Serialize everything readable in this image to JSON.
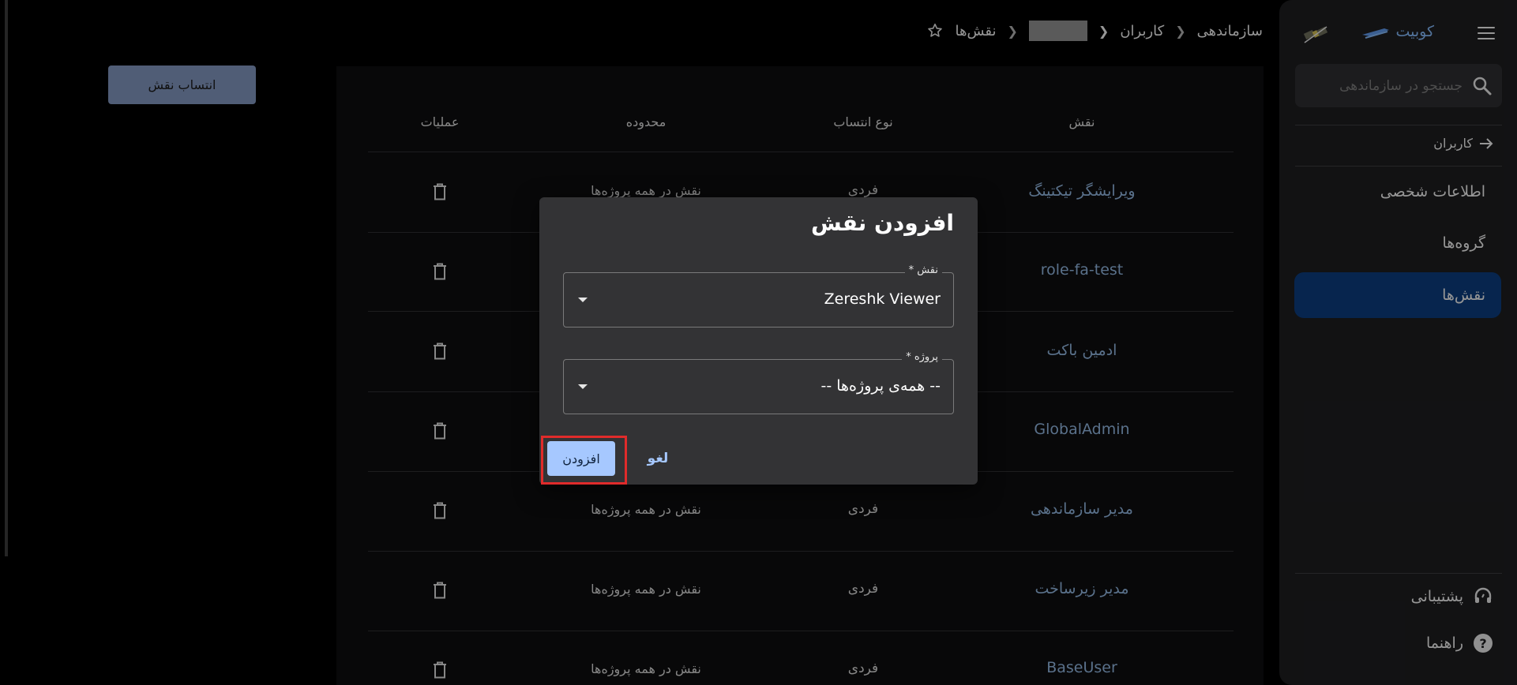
{
  "sidebar": {
    "brand": "کوبیت",
    "search_placeholder": "جستجو در سازماندهی",
    "back_label": "کاربران",
    "items": [
      {
        "label": "اطلاعات شخصی"
      },
      {
        "label": "گروه‌ها"
      },
      {
        "label": "نقش‌ها"
      }
    ],
    "support_label": "پشتیبانی",
    "help_label": "راهنما"
  },
  "header": {
    "crumbs": [
      "سازماندهی",
      "کاربران",
      "نقش‌ها"
    ]
  },
  "assign_button": "انتساب نقش",
  "table": {
    "headers": [
      "نقش",
      "نوع انتساب",
      "محدوده",
      "عملیات"
    ],
    "rows": [
      {
        "role": "ویرایشگر تیکتینگ",
        "type": "فردی",
        "scope": "نقش در همه پروژه‌ها"
      },
      {
        "role": "role-fa-test",
        "type": "",
        "scope": ""
      },
      {
        "role": "ادمین باکت",
        "type": "",
        "scope": ""
      },
      {
        "role": "GlobalAdmin",
        "type": "",
        "scope": ""
      },
      {
        "role": "مدیر سازماندهی",
        "type": "فردی",
        "scope": "نقش در همه پروژه‌ها"
      },
      {
        "role": "مدیر زیرساخت",
        "type": "فردی",
        "scope": "نقش در همه پروژه‌ها"
      },
      {
        "role": "BaseUser",
        "type": "فردی",
        "scope": "نقش در همه پروژه‌ها"
      }
    ]
  },
  "dialog": {
    "title": "افزودن نقش",
    "role_label": "نقش *",
    "role_value": "Zereshk Viewer",
    "project_label": "پروژه *",
    "project_value": "-- همه‌ی پروژه‌ها --",
    "add_label": "افزودن",
    "cancel_label": "لغو"
  },
  "colors": {
    "accent": "#a6c8ff",
    "active_nav": "#0b3a78",
    "link": "#8aaed6",
    "highlight": "#e02b2b"
  }
}
